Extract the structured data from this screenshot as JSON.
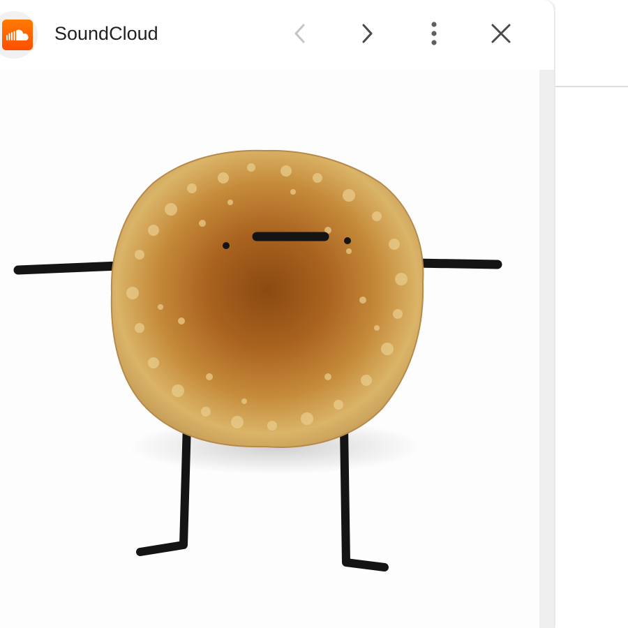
{
  "window": {
    "title": "SoundCloud",
    "app_icon": "soundcloud-icon",
    "brand_color": "#ff5500"
  },
  "toolbar": {
    "back_icon": "chevron-left-icon",
    "back_enabled": false,
    "forward_icon": "chevron-right-icon",
    "forward_enabled": true,
    "menu_icon": "more-vertical-icon",
    "close_icon": "close-icon"
  },
  "content": {
    "image_subject": "pancake-character"
  }
}
